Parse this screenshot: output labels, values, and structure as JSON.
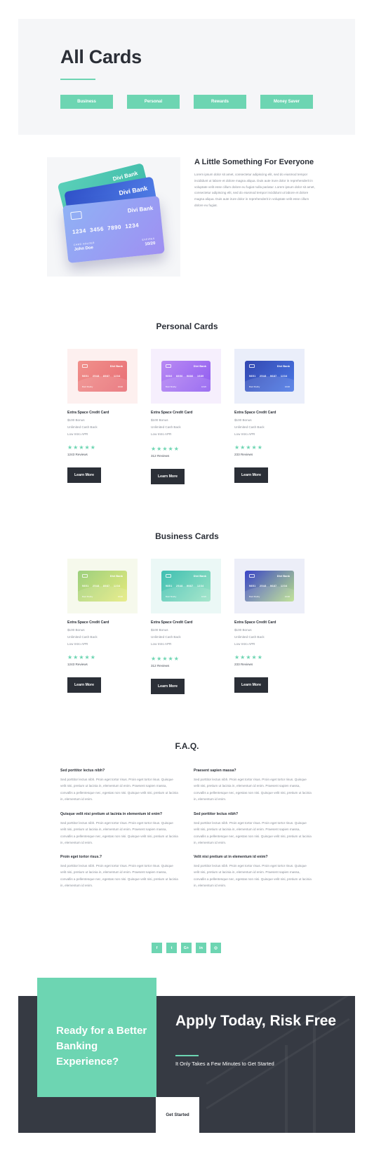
{
  "hero": {
    "title": "All Cards",
    "tabs": [
      "Business",
      "Personal",
      "Rewards",
      "Money Saver"
    ]
  },
  "intro": {
    "title": "A Little Something For Everyone",
    "text": "Lorem ipsum dolor sit amet, consectetur adipiscing elit, sed do eiusmod tempor incididunt ut labore et dolore magna aliqua. Duis aute irure dolor in reprehenderit in voluptate velit esse cillum dolore eu fugiat nulla pariatur. Lorem ipsum dolor sit amet, consectetur adipiscing elit, sed do eiusmod tempor incididunt ut labore et dolore magna aliqua. Duis aute irure dolor in reprehenderit in voluptate velit esse cillum dolore eu fugiat.",
    "hero_card": {
      "bank": "Divi Bank",
      "number": "1234  3456  7890  1234",
      "holder_label": "CARD HOLDER",
      "holder": "John Doe",
      "expires_label": "EXPIRES",
      "expires": "10/20"
    }
  },
  "personal": {
    "title": "Personal Cards",
    "cards": [
      {
        "name": "Extra Space Credit Card",
        "lines": [
          "$100 Bonus",
          "Unlimited Cash Back",
          "Low Intro APR"
        ],
        "reviews": "1243 Reviews",
        "button": "Learn More",
        "card_number": "9851  2548  8987  1234",
        "bank": "Divi Bank",
        "holder": "Brett Shelby",
        "exp": "10/20",
        "colors": [
          "#f0918c",
          "#e86d74"
        ],
        "bg": "#fdf0ef"
      },
      {
        "name": "Extra Space Credit Card",
        "lines": [
          "$100 Bonus",
          "Unlimited Cash Back",
          "Low Intro APR"
        ],
        "reviews": "312 Reviews",
        "button": "Learn More",
        "card_number": "9866  8856  9886  1689",
        "bank": "Divi Bank",
        "holder": "Brett Shelby",
        "exp": "10/20",
        "colors": [
          "#b98af3",
          "#8f5cf0"
        ],
        "bg": "#f6effd"
      },
      {
        "name": "Extra Space Credit Card",
        "lines": [
          "$100 Bonus",
          "Unlimited Cash Back",
          "Low Intro APR"
        ],
        "reviews": "233 Reviews",
        "button": "Learn More",
        "card_number": "9851  2548  9687  1234",
        "bank": "Divi Bank",
        "holder": "Brett Shelby",
        "exp": "10/20",
        "colors": [
          "#3347b0",
          "#4a78e6"
        ],
        "bg": "#eaeefa"
      }
    ]
  },
  "business": {
    "title": "Business Cards",
    "cards": [
      {
        "name": "Extra Space Credit Card",
        "lines": [
          "$100 Bonus",
          "Unlimited Cash Back",
          "Low Intro APR"
        ],
        "reviews": "1243 Reviews",
        "button": "Learn More",
        "card_number": "9851  2548  8987  1234",
        "bank": "Divi Bank",
        "holder": "Brett Shelby",
        "exp": "10/20",
        "colors": [
          "#9ccf7e",
          "#e5ea7c"
        ],
        "bg": "#f6f9ec"
      },
      {
        "name": "Extra Space Credit Card",
        "lines": [
          "$100 Bonus",
          "Unlimited Cash Back",
          "Low Intro APR"
        ],
        "reviews": "312 Reviews",
        "button": "Learn More",
        "card_number": "9851  2548  9987  1234",
        "bank": "Divi Bank",
        "holder": "Brett Shelby",
        "exp": "10/20",
        "colors": [
          "#3fbfb2",
          "#9ae3c4"
        ],
        "bg": "#ebf8f6"
      },
      {
        "name": "Extra Space Credit Card",
        "lines": [
          "$100 Bonus",
          "Unlimited Cash Back",
          "Low Intro APR"
        ],
        "reviews": "233 Reviews",
        "button": "Learn More",
        "card_number": "9851  2548  9687  1234",
        "bank": "Divi Bank",
        "holder": "Brett Shelby",
        "exp": "10/20",
        "colors": [
          "#3a44c8",
          "#b9e08a"
        ],
        "bg": "#eceef8"
      }
    ]
  },
  "faq": {
    "title": "F.A.Q.",
    "items": [
      {
        "q": "Sed porttitor lectus nibh?",
        "a": "Sed porttitor lectus nibh. Proin eget tortor risus. Proin eget tortor risus. Quisque velit nisi, pretium ut lacinia in, elementum id enim. Praesent sapien massa, convallis a pellentesque nec, egestas non nisi. Quisque velit nisi, pretium ut lacinia in, elementum id enim."
      },
      {
        "q": "Praesent sapien massa?",
        "a": "Sed porttitor lectus nibh. Proin eget tortor risus. Proin eget tortor risus. Quisque velit nisi, pretium ut lacinia in, elementum id enim. Praesent sapien massa, convallis a pellentesque nec, egestas non nisi. Quisque velit nisi, pretium ut lacinia in, elementum id enim."
      },
      {
        "q": "Quisque velit nisi pretium ut lacinia in elementum id enim?",
        "a": "Sed porttitor lectus nibh. Proin eget tortor risus. Proin eget tortor risus. Quisque velit nisi, pretium ut lacinia in, elementum id enim. Praesent sapien massa, convallis a pellentesque nec, egestas non nisi. Quisque velit nisi, pretium ut lacinia in, elementum id enim."
      },
      {
        "q": "Sed porttitor lectus nibh?",
        "a": "Sed porttitor lectus nibh. Proin eget tortor risus. Proin eget tortor risus. Quisque velit nisi, pretium ut lacinia in, elementum id enim. Praesent sapien massa, convallis a pellentesque nec, egestas non nisi. Quisque velit nisi, pretium ut lacinia in, elementum id enim."
      },
      {
        "q": "Proin eget tortor risus.?",
        "a": "Sed porttitor lectus nibh. Proin eget tortor risus. Proin eget tortor risus. Quisque velit nisi, pretium ut lacinia in, elementum id enim. Praesent sapien massa, convallis a pellentesque nec, egestas non nisi. Quisque velit nisi, pretium ut lacinia in, elementum id enim."
      },
      {
        "q": "Velit nisi pretium ut in elementum id enim?",
        "a": "Sed porttitor lectus nibh. Proin eget tortor risus. Proin eget tortor risus. Quisque velit nisi, pretium ut lacinia in, elementum id enim. Praesent sapien massa, convallis a pellentesque nec, egestas non nisi. Quisque velit nisi, pretium ut lacinia in, elementum id enim."
      }
    ]
  },
  "social": [
    {
      "name": "facebook-icon",
      "glyph": "f"
    },
    {
      "name": "twitter-icon",
      "glyph": "t"
    },
    {
      "name": "google-plus-icon",
      "glyph": "G+"
    },
    {
      "name": "linkedin-icon",
      "glyph": "in"
    },
    {
      "name": "instagram-icon",
      "glyph": "◎"
    }
  ],
  "cta": {
    "green_text": "Ready for a Better Banking Experience?",
    "title": "Apply Today, Risk Free",
    "subtitle": "It Only Takes a Few Minutes to Get Started",
    "button": "Get Started"
  },
  "colors": {
    "accent": "#6dd5b2",
    "dark": "#2b2f37",
    "panel": "#f5f6f8"
  }
}
